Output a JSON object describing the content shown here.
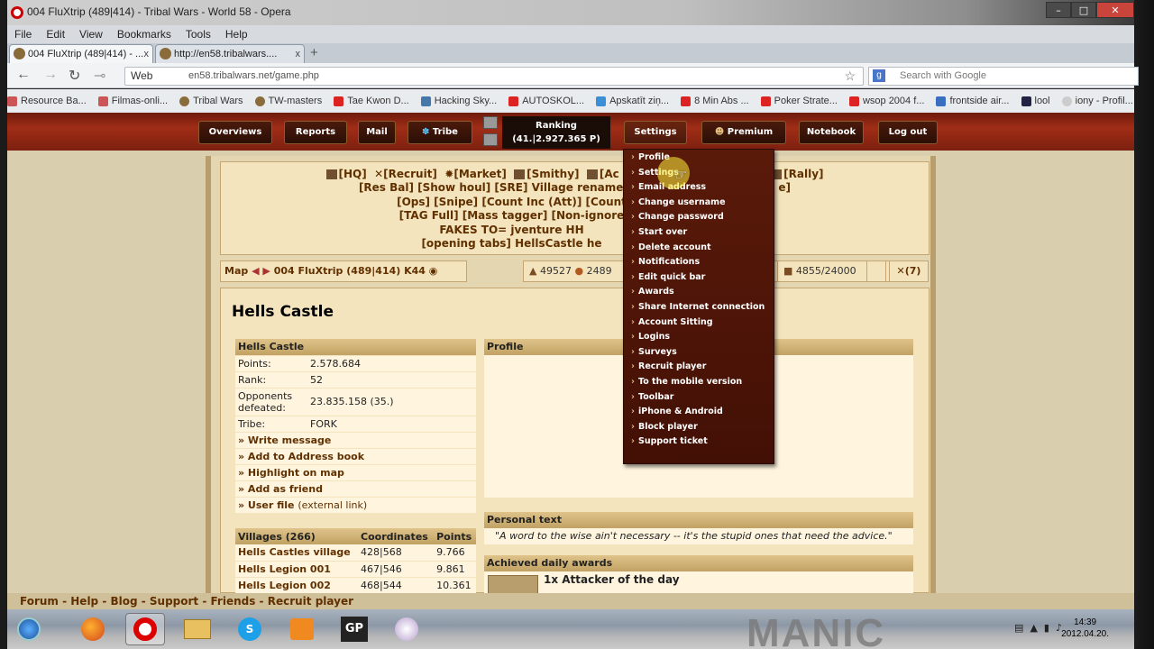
{
  "window": {
    "title": "004 FluXtrip (489|414) - Tribal Wars - World 58 - Opera"
  },
  "menubar": [
    "File",
    "Edit",
    "View",
    "Bookmarks",
    "Tools",
    "Help"
  ],
  "tabs": [
    {
      "label": "004 FluXtrip (489|414) - ...",
      "close": "x"
    },
    {
      "label": "http://en58.tribalwars....",
      "close": "x"
    }
  ],
  "address": {
    "web_label": "Web",
    "url": "en58.tribalwars.net/game.php"
  },
  "search": {
    "placeholder": "Search with Google"
  },
  "bookmarks": [
    "Resource Ba...",
    "Filmas-onli...",
    "Tribal Wars",
    "TW-masters",
    "Tae Kwon D...",
    "Hacking Sky...",
    "AUTOSKOL...",
    "Apskatīt ziņ...",
    "8 Min Abs ...",
    "Poker Strate...",
    "wsop 2004 f...",
    "frontside air...",
    "lool",
    "iony - Profil..."
  ],
  "game_nav": {
    "overviews": "Overviews",
    "reports": "Reports",
    "mail": "Mail",
    "tribe": "Tribe",
    "ranking_label": "Ranking",
    "ranking_value": "(41.|2.927.365 P)",
    "settings": "Settings",
    "premium": "Premium",
    "notebook": "Notebook",
    "logout": "Log out"
  },
  "quickbar": {
    "line1": [
      "[HQ]",
      "[Recruit]",
      "[Market]",
      "[Smithy]",
      "[Ac",
      "[Rally]"
    ],
    "line2": "[Res Bal]   [Show houl]   [SRE]   Village rename",
    "line2b": "e]",
    "line3": "[Ops]   [Snipe]   [Count Inc (Att)]   [Count",
    "line4": "[TAG Full]   [Mass tagger]   [Non-ignore",
    "line5": "FAKES TO=   jventure   HH",
    "line6": "[opening tabs]   HellsCastle   he"
  },
  "village_bar": {
    "map": "Map",
    "name": "004 FluXtrip",
    "coords": "(489|414) K44"
  },
  "resources": {
    "wood": "49527",
    "clay": "2489",
    "farm": "4855/24000",
    "attacks": "(7)"
  },
  "profile": {
    "title": "Hells Castle",
    "table_header": "Hells Castle",
    "rows": [
      {
        "label": "Points:",
        "value": "2.578.684"
      },
      {
        "label": "Rank:",
        "value": "52"
      },
      {
        "label": "Opponents defeated:",
        "value": "23.835.158 (35.)"
      },
      {
        "label": "Tribe:",
        "value": "FORK"
      }
    ],
    "links": [
      "» Write message",
      "» Add to Address book",
      "» Highlight on map",
      "» Add as friend"
    ],
    "user_file": "» User file",
    "user_file_ext": "(external link)",
    "profile_header": "Profile",
    "personal_text_header": "Personal text",
    "personal_text": "\"A word to the wise ain't necessary -- it's the stupid ones that need the advice.\"",
    "awards_header": "Achieved daily awards",
    "award_1": "1x Attacker of the day"
  },
  "villages": {
    "headers": [
      "Villages (266)",
      "Coordinates",
      "Points"
    ],
    "rows": [
      [
        "Hells Castles village",
        "428|568",
        "9.766"
      ],
      [
        "Hells Legion 001",
        "467|546",
        "9.861"
      ],
      [
        "Hells Legion 002",
        "468|544",
        "10.361"
      ]
    ]
  },
  "settings_menu": [
    "Profile",
    "Settings",
    "Email address",
    "Change username",
    "Change password",
    "Start over",
    "Delete account",
    "Notifications",
    "Edit quick bar",
    "Awards",
    "Share Internet connection",
    "Account Sitting",
    "Logins",
    "Surveys",
    "Recruit player",
    "To the mobile version",
    "Toolbar",
    "iPhone & Android",
    "Block player",
    "Support ticket"
  ],
  "footer": "Forum  -  Help  -  Blog  -  Support  -  Friends  -  Recruit player",
  "taskbar": {
    "time": "14:39",
    "date": "2012.04.20.",
    "watermark": "MANIC"
  }
}
